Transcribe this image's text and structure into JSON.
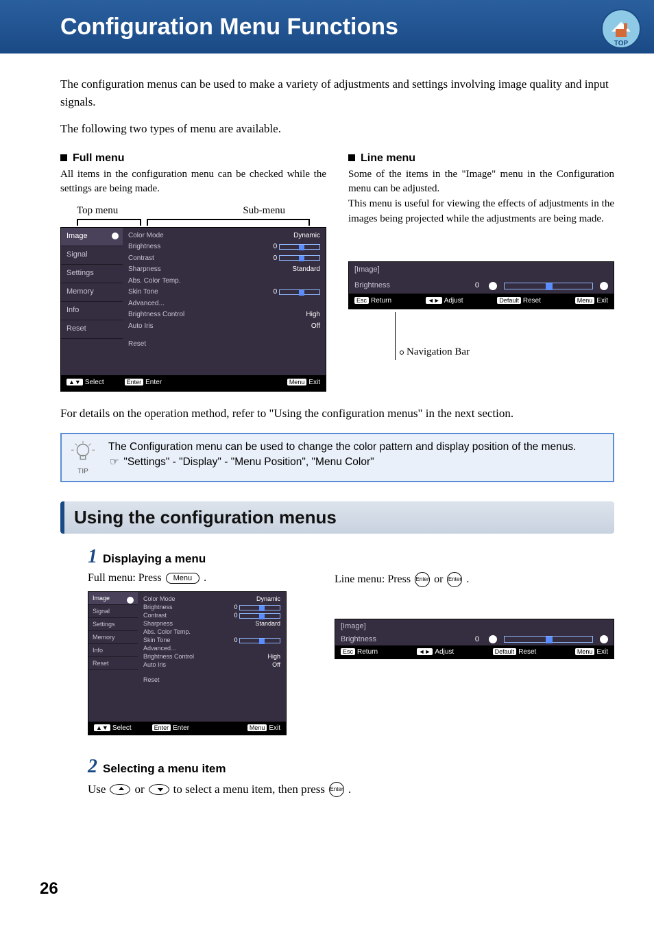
{
  "header": {
    "title": "Configuration Menu Functions",
    "badge_label": "TOP"
  },
  "intro": {
    "p1": "The configuration menus can be used to make a variety of adjustments and settings involving image quality and input signals.",
    "p2": "The following two types of menu are available."
  },
  "full_menu": {
    "head": "Full menu",
    "desc": "All items in the configuration menu can be checked while the settings are being made.",
    "label_top": "Top menu",
    "label_sub": "Sub-menu",
    "top_items": [
      "Image",
      "Signal",
      "Settings",
      "Memory",
      "Info",
      "Reset"
    ],
    "sub_items": [
      {
        "k": "Color Mode",
        "v": "Dynamic"
      },
      {
        "k": "Brightness",
        "v": "0",
        "slider": true
      },
      {
        "k": "Contrast",
        "v": "0",
        "slider": true
      },
      {
        "k": "Sharpness",
        "v": "Standard"
      },
      {
        "k": "Abs. Color Temp.",
        "v": ""
      },
      {
        "k": "Skin Tone",
        "v": "0",
        "slider": true
      },
      {
        "k": "Advanced...",
        "v": ""
      },
      {
        "k": "Brightness Control",
        "v": "High"
      },
      {
        "k": "Auto Iris",
        "v": "Off"
      }
    ],
    "reset": "Reset",
    "foot_select": "Select",
    "foot_enter": "Enter",
    "foot_exit": "Exit"
  },
  "line_menu": {
    "head": "Line menu",
    "desc1": "Some of the items in the \"Image\" menu in the Configuration menu can be adjusted.",
    "desc2": "This menu is useful for viewing the effects of adjustments in the images being projected while the adjustments are being made.",
    "panel_head": "[Image]",
    "panel_item": "Brightness",
    "panel_val": "0",
    "foot_return": "Return",
    "foot_adjust": "Adjust",
    "foot_reset": "Reset",
    "foot_exit": "Exit",
    "navbar_label": "Navigation Bar"
  },
  "details_line": "For details on the operation method, refer to \"Using the configuration menus\" in the next section.",
  "tip": {
    "label": "TIP",
    "line1": "The Configuration menu can be used to change the color pattern and display position of the menus.",
    "line2": "\"Settings\" - \"Display\" - \"Menu Position\", \"Menu Color\""
  },
  "section2": {
    "title": "Using the configuration menus"
  },
  "step1": {
    "num": "1",
    "title": "Displaying a menu",
    "full_press_a": "Full menu: Press ",
    "full_press_key": "Menu",
    "line_press_a": "Line menu: Press ",
    "line_press_key": "Enter",
    "or": " or "
  },
  "step2": {
    "num": "2",
    "title": "Selecting a menu item",
    "use_a": "Use ",
    "use_mid": " or ",
    "use_b": " to select a menu item, then press ",
    "key": "Enter",
    "end": " ."
  },
  "page_number": "26"
}
